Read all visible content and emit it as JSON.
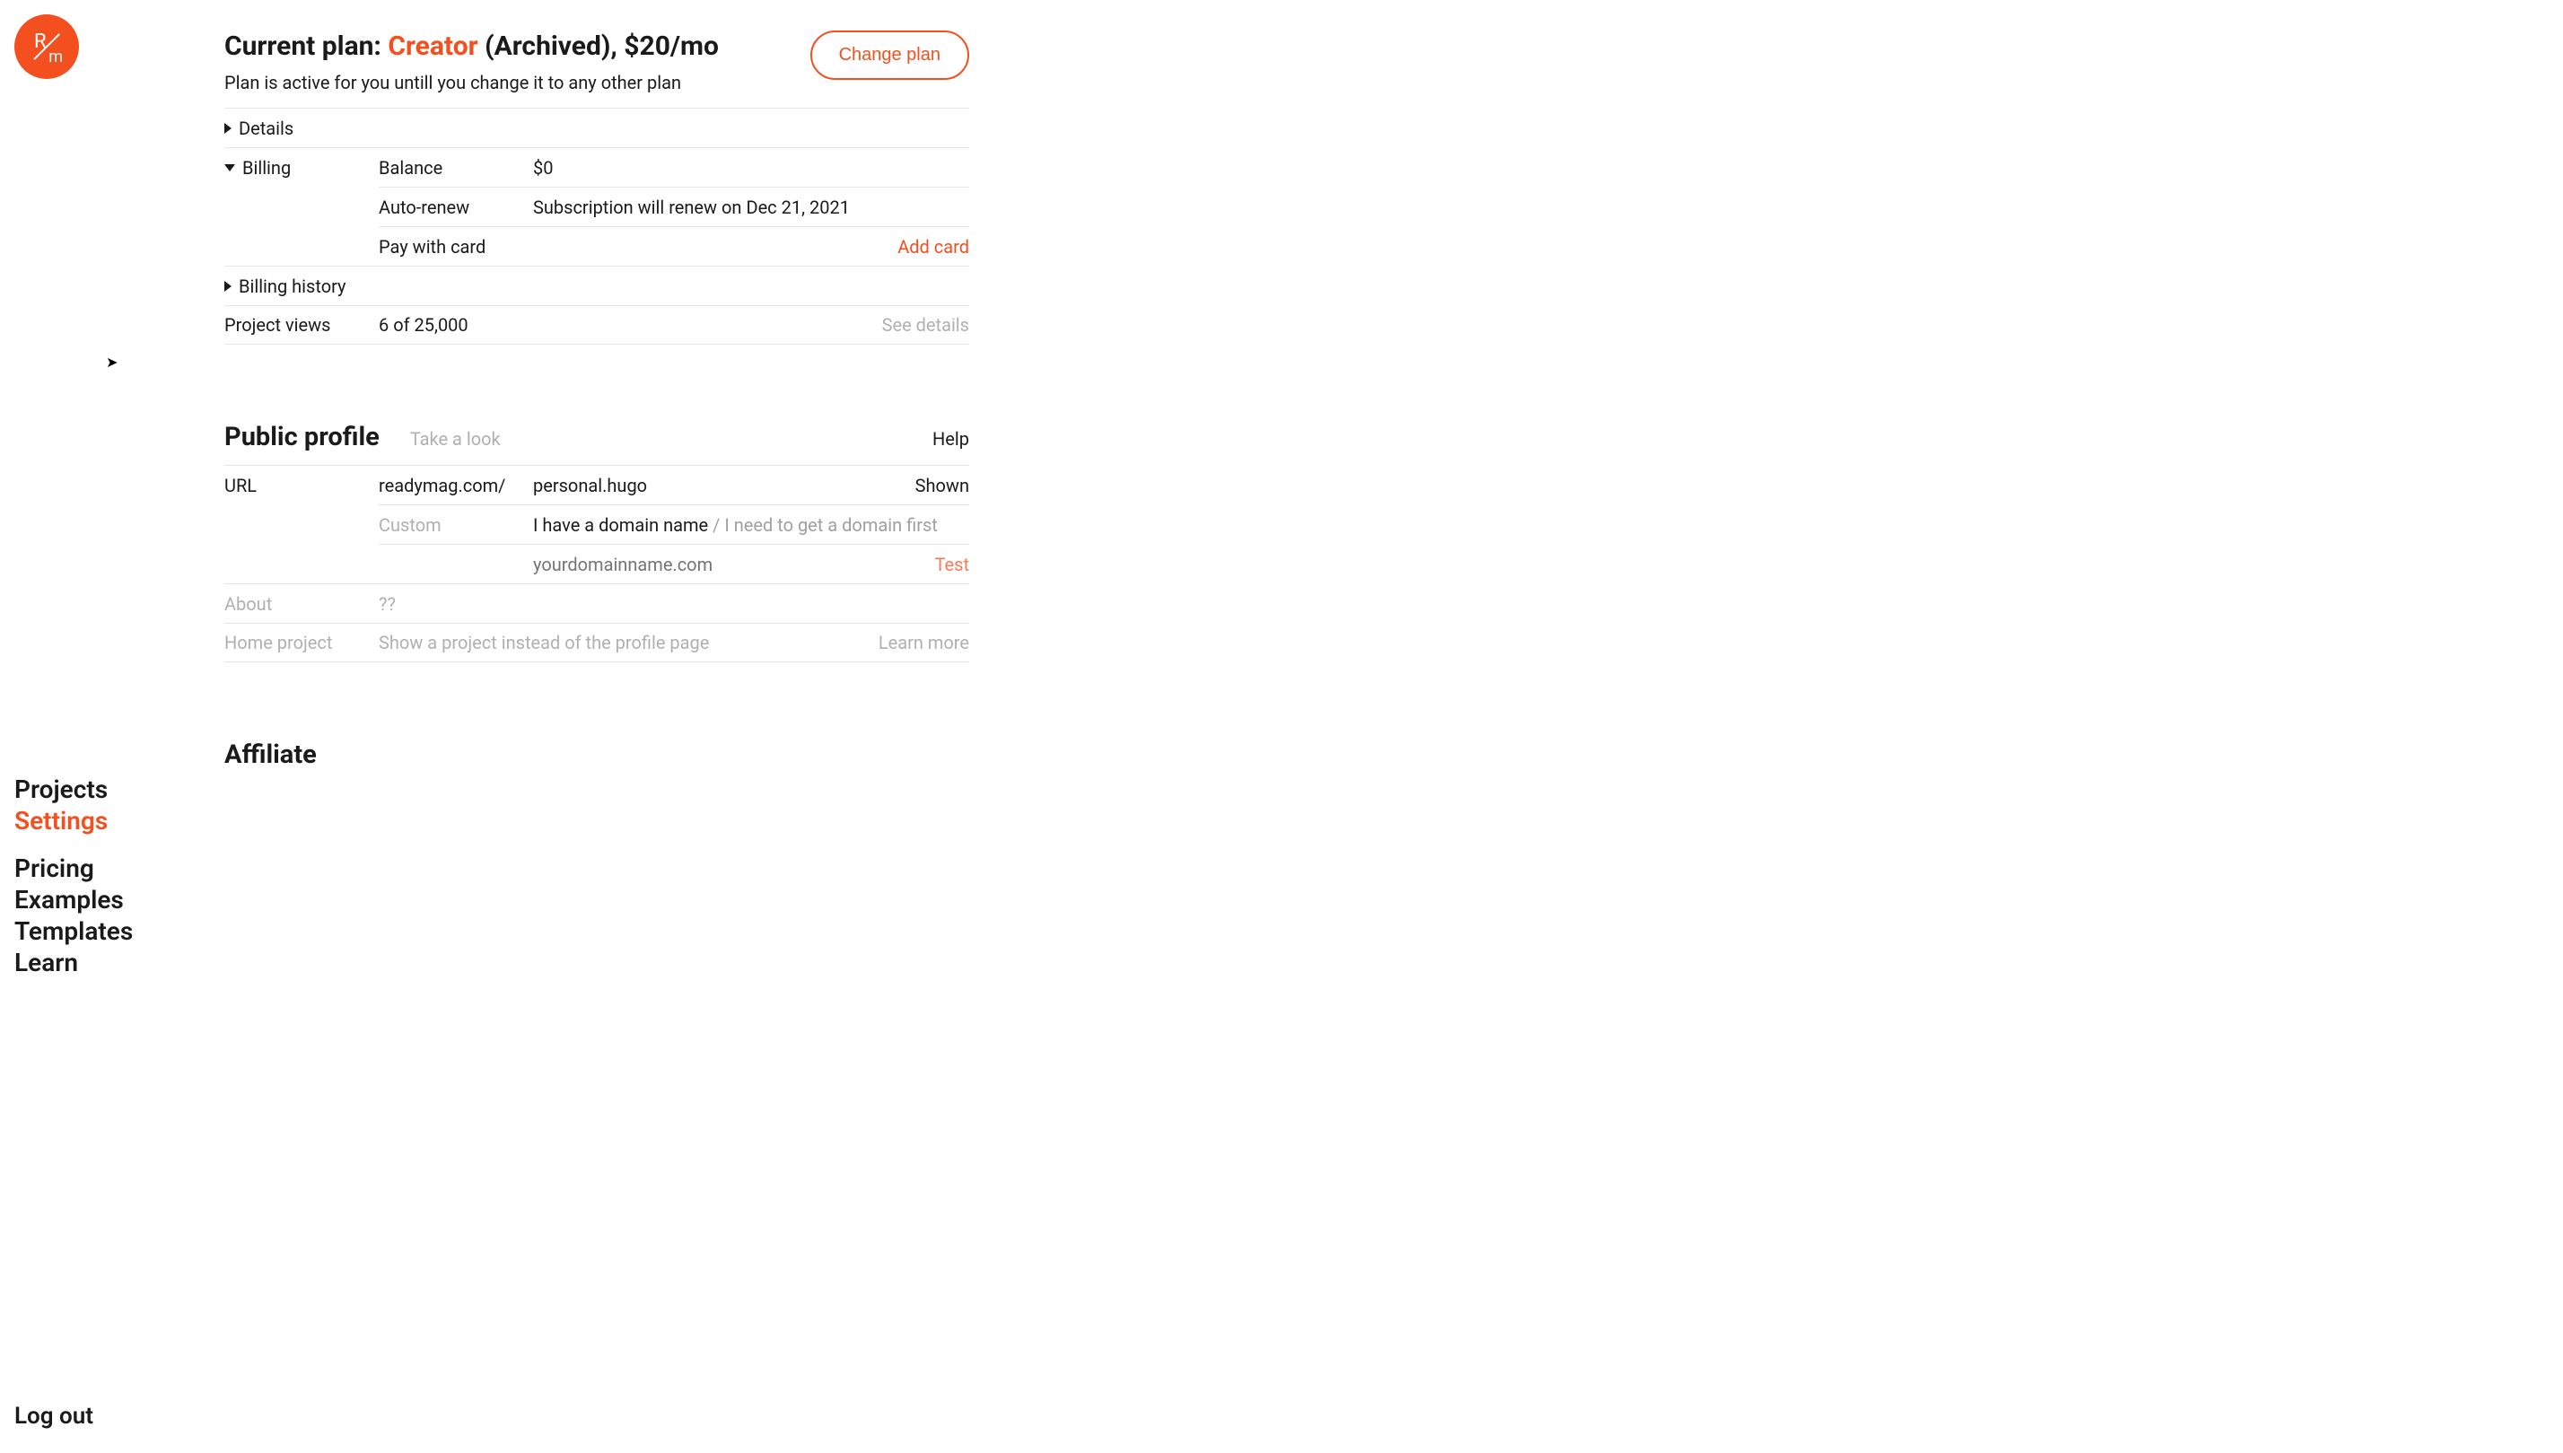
{
  "logo": {
    "r": "R",
    "m": "m"
  },
  "nav": {
    "projects": "Projects",
    "settings": "Settings",
    "pricing": "Pricing",
    "examples": "Examples",
    "templates": "Templates",
    "learn": "Learn",
    "logout": "Log out"
  },
  "plan": {
    "prefix": "Current plan: ",
    "name": "Creator",
    "suffix": " (Archived), $20/mo",
    "subtitle": "Plan is active for you untill you change it to any other plan",
    "change_btn": "Change plan"
  },
  "details": {
    "label": "Details"
  },
  "billing": {
    "label": "Billing",
    "balance_label": "Balance",
    "balance_value": "$0",
    "autorenew_label": "Auto-renew",
    "autorenew_value": "Subscription will renew on Dec 21, 2021",
    "paywithcard_label": "Pay with card",
    "add_card": "Add card"
  },
  "billing_history": {
    "label": "Billing history"
  },
  "project_views": {
    "label": "Project views",
    "value": "6 of 25,000",
    "see_details": "See details"
  },
  "profile": {
    "title": "Public profile",
    "take_a_look": "Take a look",
    "help": "Help",
    "url_label": "URL",
    "url_prefix": "readymag.com/",
    "url_value": "personal.hugo",
    "shown": "Shown",
    "custom_label": "Custom",
    "have_domain": "I have a domain name",
    "slash": " / ",
    "need_domain": "I need to get a domain first",
    "domain_placeholder": "yourdomainname.com",
    "test": "Test",
    "about_label": "About",
    "about_value": "??",
    "home_project_label": "Home project",
    "home_project_desc": "Show a project instead of the profile page",
    "learn_more": "Learn more"
  },
  "affiliate": {
    "title": "Affiliate"
  }
}
